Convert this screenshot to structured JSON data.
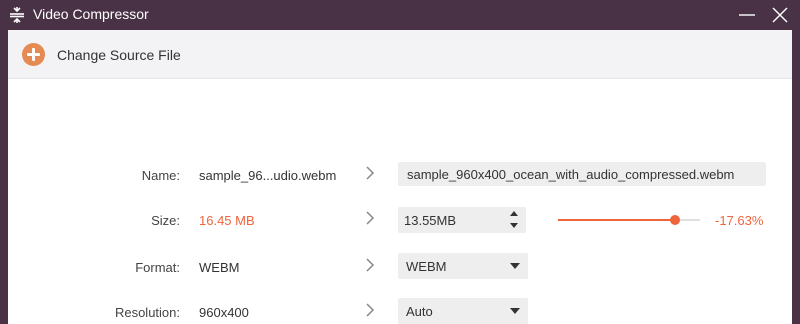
{
  "titlebar": {
    "title": "Video Compressor",
    "app_icon": "compress-icon",
    "minimize_icon": "minimize-icon",
    "close_icon": "close-icon"
  },
  "toolbar": {
    "change_source_label": "Change Source File",
    "change_source_icon": "plus-circle-icon"
  },
  "rows": {
    "name": {
      "label": "Name:",
      "source": "sample_96...udio.webm",
      "output": "sample_960x400_ocean_with_audio_compressed.webm"
    },
    "size": {
      "label": "Size:",
      "source": "16.45 MB",
      "output": "13.55MB",
      "ratio_percent": "-17.63%",
      "slider_level": 0.8237
    },
    "format": {
      "label": "Format:",
      "source": "WEBM",
      "output": "WEBM"
    },
    "resolution": {
      "label": "Resolution:",
      "source": "960x400",
      "output": "Auto"
    }
  },
  "colors": {
    "titlebar_bg": "#4a3246",
    "accent": "#f0643c",
    "plus_icon": "#e58a52",
    "field_bg": "#eeeeef"
  }
}
